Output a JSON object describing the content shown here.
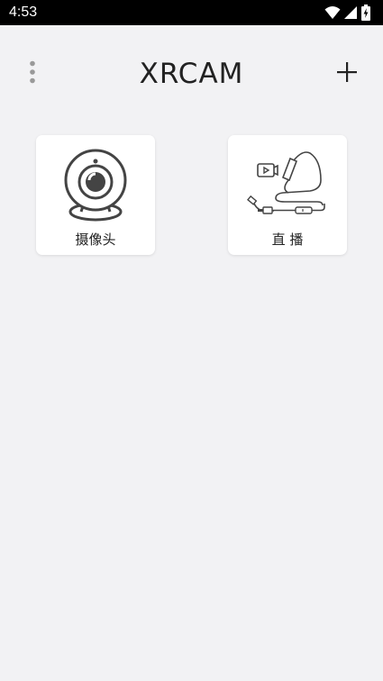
{
  "status_bar": {
    "time": "4:53",
    "icons": [
      "wifi-icon",
      "cellular-signal-icon",
      "battery-charging-icon"
    ]
  },
  "app_bar": {
    "title": "XRCAM",
    "menu_icon": "more-vert-icon",
    "add_icon": "plus-icon"
  },
  "cards": [
    {
      "label": "摄像头",
      "icon": "webcam-icon"
    },
    {
      "label": "直 播",
      "icon": "live-stream-cable-icon"
    }
  ],
  "colors": {
    "background": "#f2f2f4",
    "card": "#ffffff",
    "status_bar": "#000000",
    "icon_dark": "#444444",
    "text": "#222222"
  }
}
